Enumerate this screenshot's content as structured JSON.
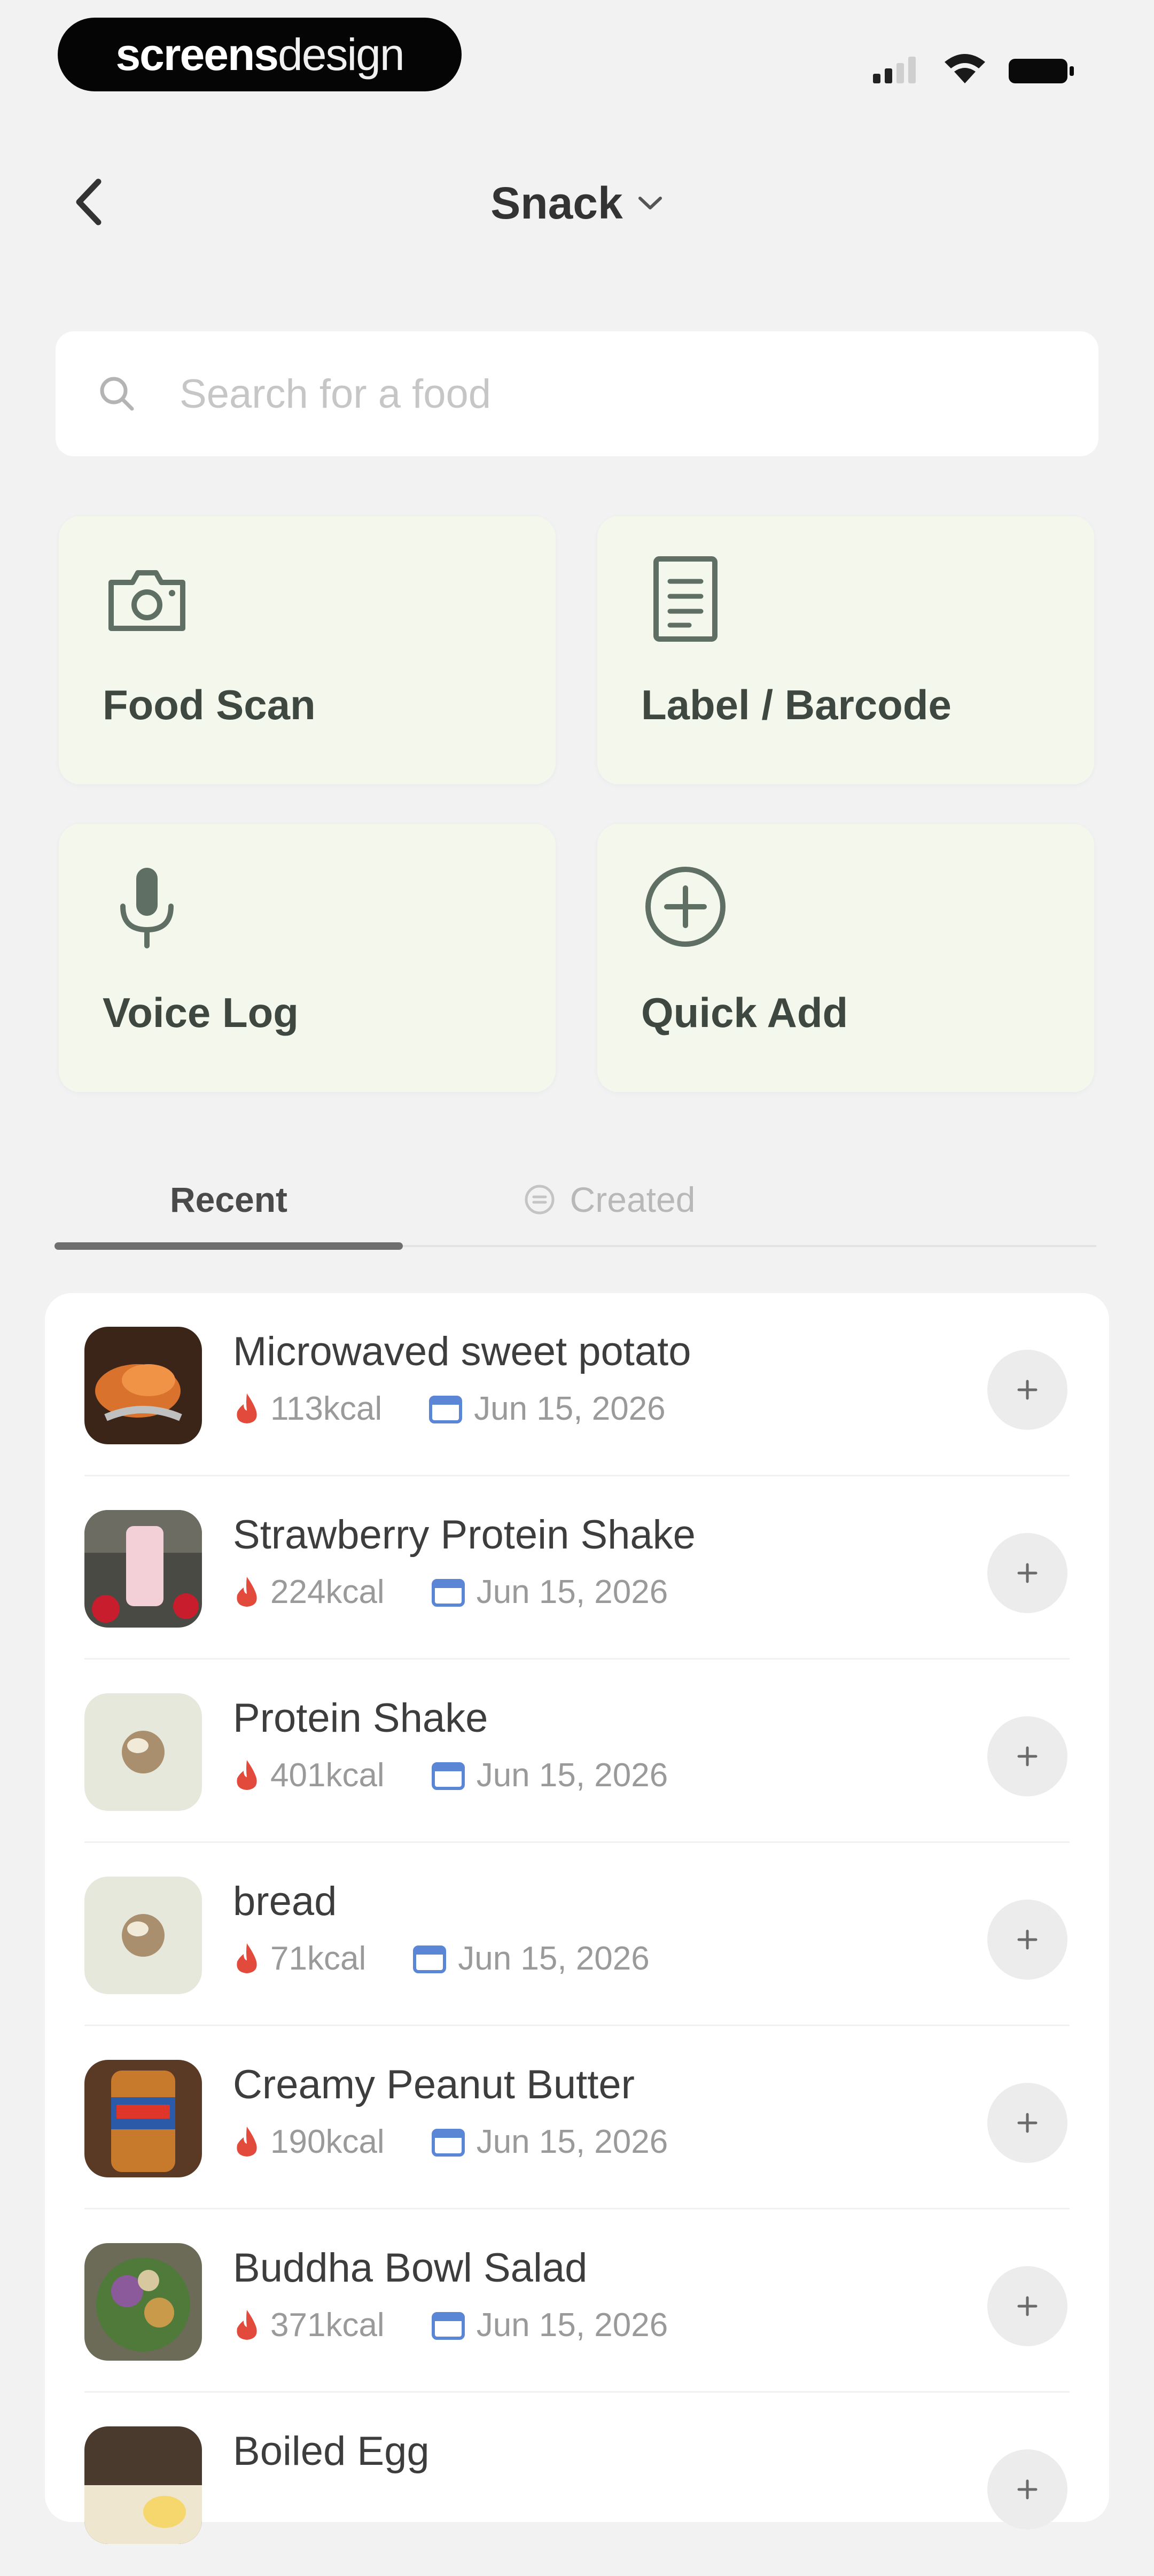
{
  "status_bar": {
    "brand_bold": "screens",
    "brand_light": "design"
  },
  "header": {
    "title": "Snack"
  },
  "search": {
    "placeholder": "Search for a food",
    "value": ""
  },
  "actions": [
    {
      "label": "Food Scan",
      "icon": "camera-icon"
    },
    {
      "label": "Label / Barcode",
      "icon": "document-icon"
    },
    {
      "label": "Voice Log",
      "icon": "microphone-icon"
    },
    {
      "label": "Quick Add",
      "icon": "plus-circle-icon"
    }
  ],
  "tabs": [
    {
      "label": "Recent",
      "active": true
    },
    {
      "label": "Created",
      "active": false
    }
  ],
  "foods": [
    {
      "name": "Microwaved sweet potato",
      "kcal": "113kcal",
      "date": "Jun 15, 2026"
    },
    {
      "name": "Strawberry Protein Shake",
      "kcal": "224kcal",
      "date": "Jun 15, 2026"
    },
    {
      "name": "Protein Shake",
      "kcal": "401kcal",
      "date": "Jun 15, 2026"
    },
    {
      "name": "bread",
      "kcal": "71kcal",
      "date": "Jun 15, 2026"
    },
    {
      "name": "Creamy Peanut Butter",
      "kcal": "190kcal",
      "date": "Jun 15, 2026"
    },
    {
      "name": "Buddha Bowl Salad",
      "kcal": "371kcal",
      "date": "Jun 15, 2026"
    },
    {
      "name": "Boiled Egg",
      "kcal": "",
      "date": ""
    }
  ],
  "colors": {
    "background": "#f2f2f2",
    "tile_bg": "#f4f8ec",
    "icon_green": "#5f6f63",
    "flame_red": "#e24a3b",
    "calendar_blue": "#5b86d6"
  }
}
